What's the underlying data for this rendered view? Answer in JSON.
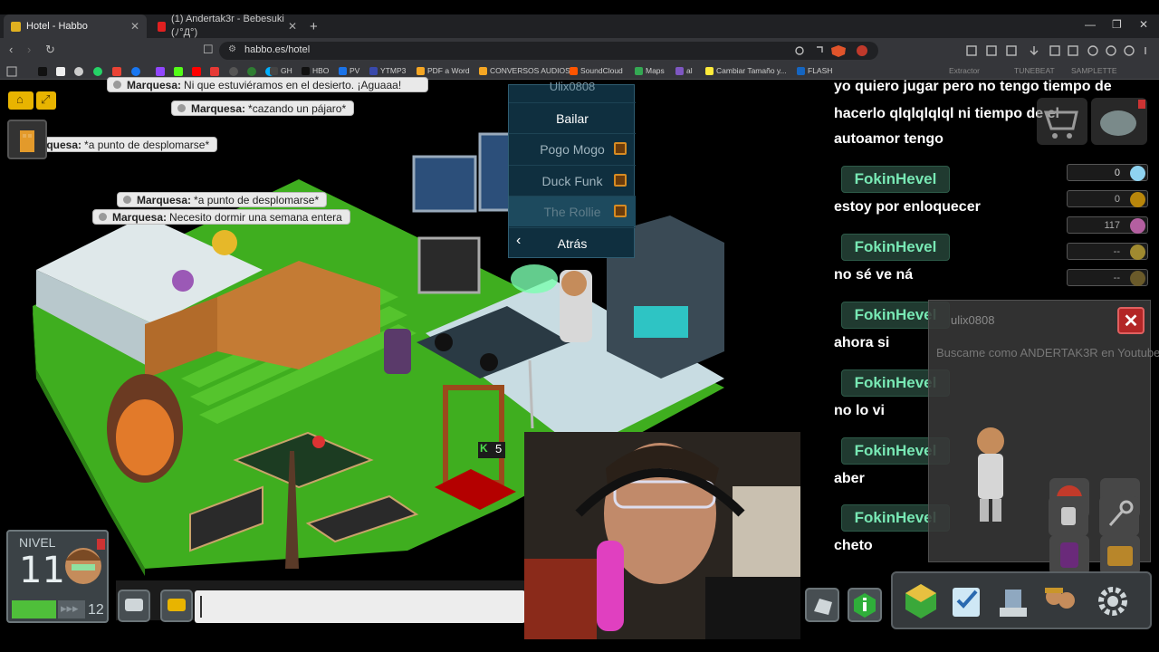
{
  "browser": {
    "tabs": [
      {
        "title": "Hotel - Habbo",
        "close": "✕"
      },
      {
        "title": "(1) Andertak3r - Bebesuki (ﾉ°Д°)",
        "close": "✕"
      }
    ],
    "new_tab": "+",
    "url": "habbo.es/hotel",
    "window_controls": [
      "—",
      "❐",
      "✕"
    ],
    "bookmarks": [
      "GH",
      "HBO",
      "PV",
      "YTMP3",
      "PDF a Word",
      "CONVERSOS AUDIOS",
      "SoundCloud",
      "Maps",
      "al",
      "Cambiar Tamaño y...",
      "FLASH",
      "Extractor",
      "TUNEBEAT",
      "SAMPLETTE"
    ]
  },
  "room_chat": [
    {
      "user": "Marquesa:",
      "text": "Ni que estuviéramos en el desierto. ¡Aguaaa!"
    },
    {
      "user": "Marquesa:",
      "text": "*cazando un pájaro*"
    },
    {
      "user": "Marquesa:",
      "text": "*a punto de desplomarse*"
    },
    {
      "user": "Marquesa:",
      "text": "*a punto de desplomarse*"
    },
    {
      "user": "Marquesa:",
      "text": "Necesito dormir una semana entera"
    }
  ],
  "dance_menu": {
    "title": "Ulix0808",
    "items": [
      "Bailar",
      "Pogo Mogo",
      "Duck Funk",
      "The Rollie"
    ],
    "back": "Atrás"
  },
  "side_chat": {
    "intro": [
      "yo quiero jugar pero no tengo tiempo de",
      "hacerlo qlqlqlqlql ni tiempo de el",
      "autoamor tengo"
    ],
    "messages": [
      {
        "user": "FokinHevel",
        "text": "estoy por enloquecer"
      },
      {
        "user": "FokinHevel",
        "text": "no sé ve ná"
      },
      {
        "user": "FokinHevel",
        "text": "ahora si"
      },
      {
        "user": "FokinHevel",
        "text": "no lo vi"
      },
      {
        "user": "FokinHevel",
        "text": "aber"
      },
      {
        "user": "FokinHevel",
        "text": "cheto"
      }
    ]
  },
  "currency": {
    "diamonds": "0",
    "credits": "0",
    "duckets": "117",
    "d4": "--",
    "d5": "--"
  },
  "profile": {
    "name": "ulix0808",
    "motto": "Buscame como ANDERTAK3R en Youtube",
    "close": "✕"
  },
  "level": {
    "label": "NIVEL",
    "value": "11",
    "next": "12",
    "progress": 0.6
  },
  "counter": {
    "label": "5"
  },
  "colors": {
    "accent_green": "#78e8b4",
    "menu_bg": "#0f2f3f",
    "floor_green": "#3fae1f"
  }
}
